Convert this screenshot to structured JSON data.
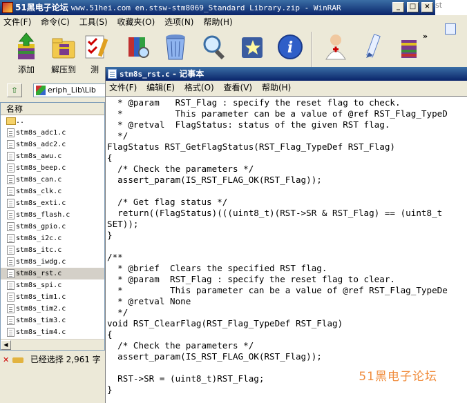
{
  "winrar": {
    "title": "51黑电子论坛",
    "title_path": "www.51hei.com en.stsw-stm8069_Standard Library.zip - WinRAR",
    "menu": [
      "文件(F)",
      "命令(C)",
      "工具(S)",
      "收藏夹(O)",
      "选项(N)",
      "帮助(H)"
    ],
    "toolbar": {
      "add_label": "添加",
      "extract_label": "解压到",
      "test_label": "测"
    },
    "caption_buttons": {
      "minimize": "_",
      "maximize": "□",
      "close": "×"
    },
    "address": "eriph_Lib\\Lib",
    "column_name": "名称",
    "files": [
      "..",
      "stm8s_adc1.c",
      "stm8s_adc2.c",
      "stm8s_awu.c",
      "stm8s_beep.c",
      "stm8s_can.c",
      "stm8s_clk.c",
      "stm8s_exti.c",
      "stm8s_flash.c",
      "stm8s_gpio.c",
      "stm8s_i2c.c",
      "stm8s_itc.c",
      "stm8s_iwdg.c",
      "stm8s_rst.c",
      "stm8s_spi.c",
      "stm8s_tim1.c",
      "stm8s_tim2.c",
      "stm8s_tim3.c",
      "stm8s_tim4.c"
    ],
    "selected_file": "stm8s_rst.c",
    "status": "已经选择 2,961 字",
    "right_fragment": "st"
  },
  "notepad": {
    "title_file": "stm8s_rst.c",
    "title_app": " - 记事本",
    "menu": [
      "文件(F)",
      "编辑(E)",
      "格式(O)",
      "查看(V)",
      "帮助(H)"
    ],
    "code_lines": [
      "  * @param   RST_Flag : specify the reset flag to check.",
      "  *          This parameter can be a value of @ref RST_Flag_TypeD",
      "  * @retval  FlagStatus: status of the given RST flag.",
      "  */",
      "FlagStatus RST_GetFlagStatus(RST_Flag_TypeDef RST_Flag)",
      "{",
      "  /* Check the parameters */",
      "  assert_param(IS_RST_FLAG_OK(RST_Flag));",
      "",
      "  /* Get flag status */",
      "  return((FlagStatus)(((uint8_t)(RST->SR & RST_Flag) == (uint8_t",
      "SET));",
      "}",
      "",
      "/**",
      "  * @brief  Clears the specified RST flag.",
      "  * @param  RST_Flag : specify the reset flag to clear.",
      "  *         This parameter can be a value of @ref RST_Flag_TypeDe",
      "  * @retval None",
      "  */",
      "void RST_ClearFlag(RST_Flag_TypeDef RST_Flag)",
      "{",
      "  /* Check the parameters */",
      "  assert_param(IS_RST_FLAG_OK(RST_Flag));",
      "",
      "  RST->SR = (uint8_t)RST_Flag;",
      "}"
    ],
    "watermark": "51黑电子论坛"
  },
  "colors": {
    "title_active": "#0a246a",
    "window_face": "#ece9d8",
    "selection": "#d4d0c8",
    "watermark": "#f08c3c"
  }
}
